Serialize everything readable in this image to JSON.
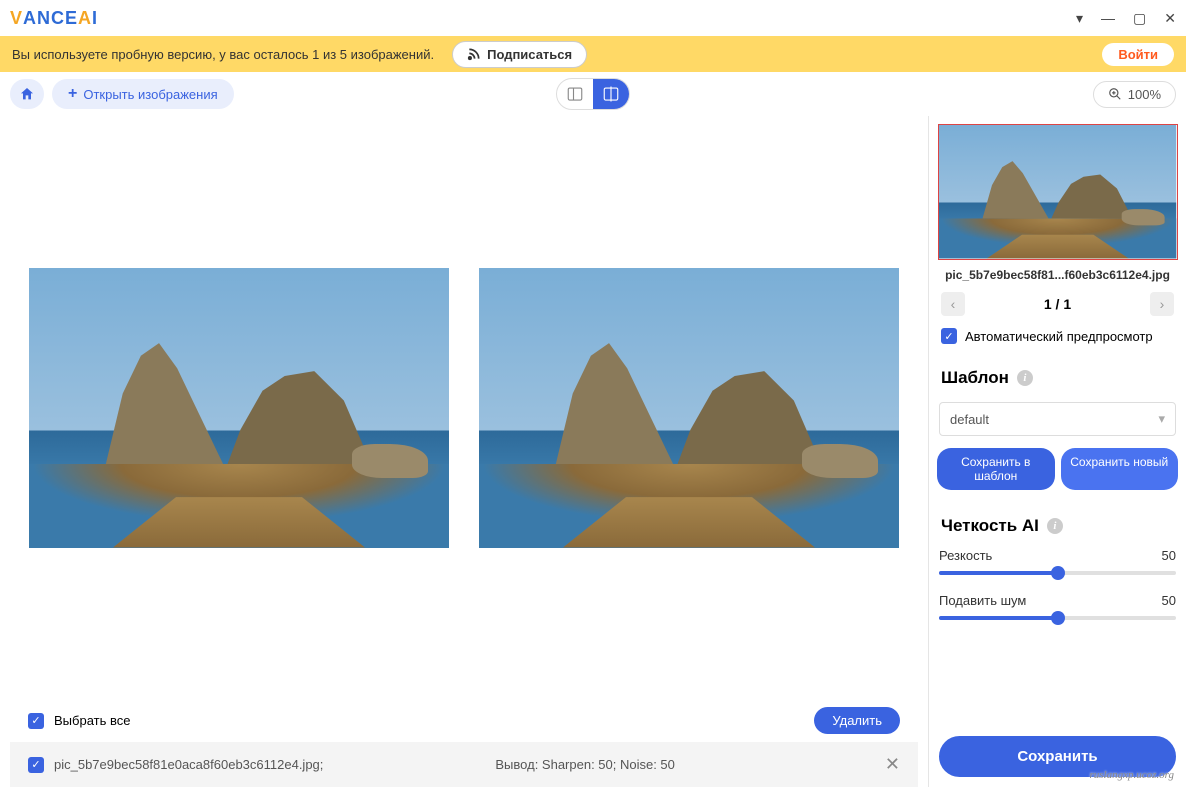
{
  "trial": {
    "message": "Вы используете пробную версию, у вас осталось 1 из 5 изображений.",
    "subscribe": "Подписаться",
    "login": "Войти"
  },
  "toolbar": {
    "open": "Открыть изображения",
    "zoom": "100%"
  },
  "files": {
    "select_all": "Выбрать все",
    "delete": "Удалить",
    "row_name": "pic_5b7e9bec58f81e0aca8f60eb3c6112e4.jpg;",
    "row_output": "Вывод: Sharpen: 50; Noise: 50"
  },
  "sidebar": {
    "filename": "pic_5b7e9bec58f81...f60eb3c6112e4.jpg",
    "page_current": "1",
    "page_sep": " / ",
    "page_total": "1",
    "auto_preview": "Автоматический предпросмотр",
    "template_title": "Шаблон",
    "template_value": "default",
    "save_template": "Сохранить в шаблон",
    "save_new": "Сохранить новый",
    "clarity_title": "Четкость AI",
    "sharpness_label": "Резкость",
    "sharpness_value": "50",
    "noise_label": "Подавить шум",
    "noise_value": "50",
    "save": "Сохранить"
  },
  "watermark": "ruslangxp.ucoz.org"
}
